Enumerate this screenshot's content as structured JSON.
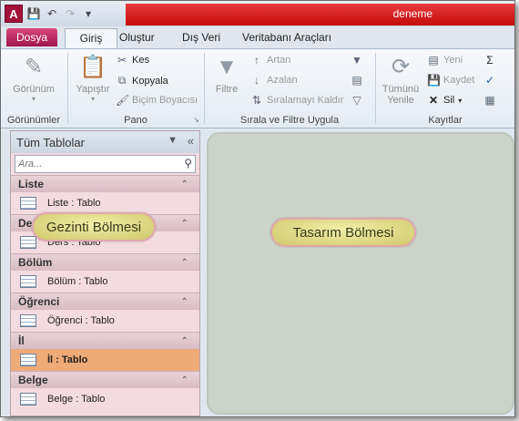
{
  "window": {
    "title": "deneme",
    "app_icon_letter": "A"
  },
  "quick_access": [
    "save-icon",
    "undo-icon",
    "redo-icon",
    "customize-icon"
  ],
  "tabs": [
    {
      "label": "Dosya"
    },
    {
      "label": "Giriş"
    },
    {
      "label": "Oluştur"
    },
    {
      "label": "Dış Veri"
    },
    {
      "label": "Veritabanı Araçları"
    }
  ],
  "ribbon": {
    "views": {
      "button": "Görünüm",
      "group": "Görünümler"
    },
    "clipboard": {
      "paste": "Yapıştır",
      "cut": "Kes",
      "copy": "Kopyala",
      "format_painter": "Biçim Boyacısı",
      "group": "Pano"
    },
    "sort_filter": {
      "filter": "Filtre",
      "ascending": "Artan",
      "descending": "Azalan",
      "remove_sort": "Sıralamayı Kaldır",
      "group": "Sırala ve Filtre Uygula"
    },
    "records": {
      "refresh_all": "Tümünü",
      "refresh_all_2": "Yenile",
      "new": "Yeni",
      "save": "Kaydet",
      "delete": "Sil",
      "group": "Kayıtlar"
    }
  },
  "nav_pane": {
    "title": "Tüm Tablolar",
    "search_placeholder": "Ara...",
    "groups": [
      {
        "name": "Liste",
        "item": "Liste : Tablo"
      },
      {
        "name": "Ders",
        "item": "Ders : Tablo"
      },
      {
        "name": "Bölüm",
        "item": "Bölüm : Tablo"
      },
      {
        "name": "Öğrenci",
        "item": "Öğrenci : Tablo"
      },
      {
        "name": "İl",
        "item": "İl : Tablo",
        "selected": true
      },
      {
        "name": "Belge",
        "item": "Belge : Tablo"
      }
    ]
  },
  "callouts": {
    "nav": "Gezinti Bölmesi",
    "design": "Tasarım Bölmesi"
  },
  "colors": {
    "title_bar": "#d41414",
    "file_tab": "#b71c56",
    "nav_background": "#f4dbe0",
    "selected_item": "#eeaa77",
    "design_area": "#cbd3ca",
    "callout": "#e6e19a"
  }
}
